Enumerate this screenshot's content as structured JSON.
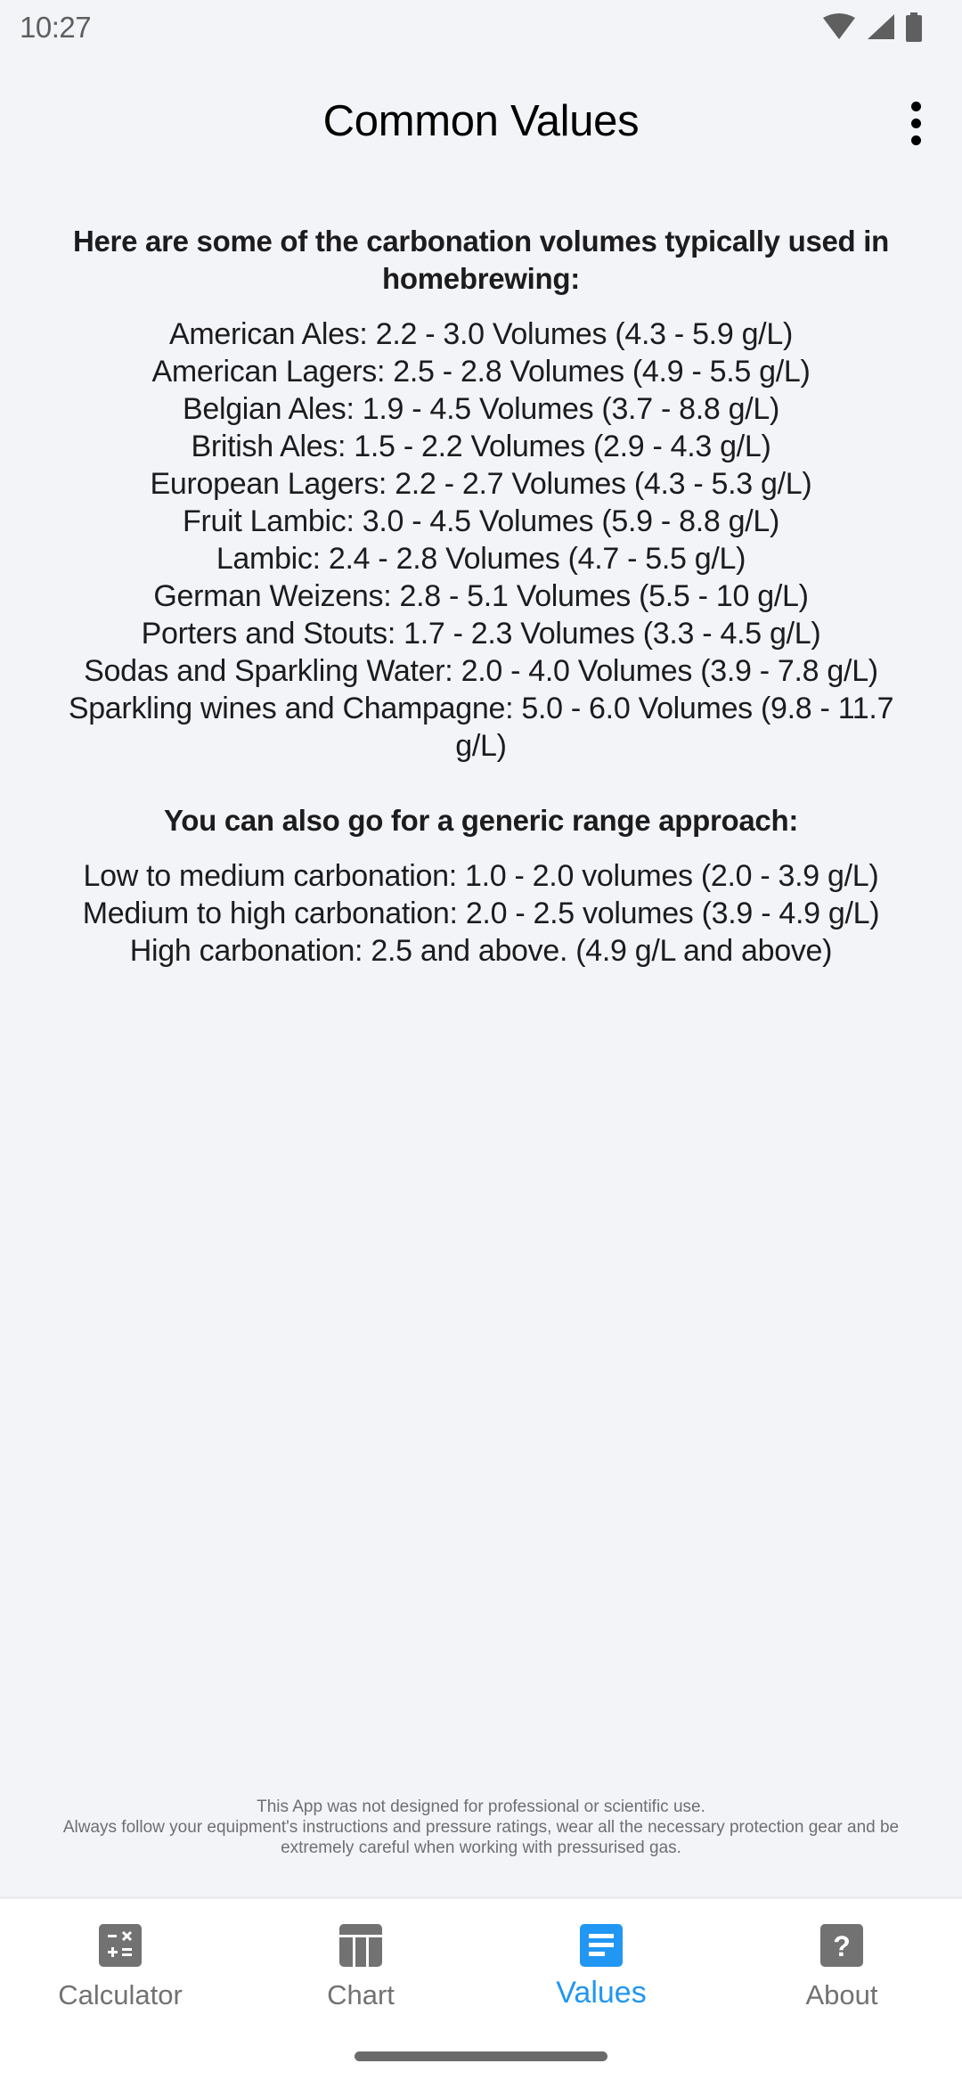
{
  "status_bar": {
    "time": "10:27",
    "icons": [
      "wifi-icon",
      "signal-icon",
      "battery-icon"
    ]
  },
  "app_bar": {
    "title": "Common Values",
    "menu_icon": "more-vert-icon"
  },
  "content": {
    "heading_1": "Here are some of the carbonation volumes typically used in homebrewing:",
    "beer_styles": [
      "American Ales: 2.2 - 3.0 Volumes (4.3 - 5.9 g/L)",
      "American Lagers: 2.5 - 2.8 Volumes (4.9 - 5.5 g/L)",
      "Belgian Ales: 1.9 - 4.5 Volumes (3.7 - 8.8 g/L)",
      "British Ales: 1.5 - 2.2 Volumes (2.9 - 4.3 g/L)",
      "European Lagers: 2.2 - 2.7 Volumes (4.3 - 5.3 g/L)",
      "Fruit Lambic: 3.0 - 4.5 Volumes (5.9 - 8.8 g/L)",
      "Lambic: 2.4 - 2.8 Volumes (4.7 - 5.5 g/L)",
      "German Weizens: 2.8 - 5.1 Volumes (5.5 - 10 g/L)",
      "Porters and Stouts: 1.7 - 2.3 Volumes (3.3 - 4.5 g/L)",
      "Sodas and Sparkling Water: 2.0 - 4.0 Volumes (3.9 - 7.8 g/L)",
      "Sparkling wines and Champagne: 5.0 - 6.0 Volumes (9.8 - 11.7 g/L)"
    ],
    "heading_2": "You can also go for a generic range approach:",
    "generic_ranges": [
      "Low to medium carbonation: 1.0 - 2.0 volumes (2.0 - 3.9 g/L)",
      "Medium to high carbonation: 2.0 - 2.5 volumes (3.9 - 4.9 g/L)",
      "High carbonation: 2.5 and above. (4.9 g/L and above)"
    ]
  },
  "footer": {
    "line_1": "This App was not designed for professional or scientific use.",
    "line_2": "Always follow your equipment's instructions and pressure ratings, wear all the necessary protection gear and be extremely careful when working with pressurised gas."
  },
  "bottom_nav": {
    "active": "Values",
    "accent_color": "#2196f3",
    "inactive_color": "#727272",
    "items": [
      {
        "label": "Calculator",
        "icon": "calculator-icon"
      },
      {
        "label": "Chart",
        "icon": "chart-icon"
      },
      {
        "label": "Values",
        "icon": "values-list-icon"
      },
      {
        "label": "About",
        "icon": "help-icon"
      }
    ]
  }
}
